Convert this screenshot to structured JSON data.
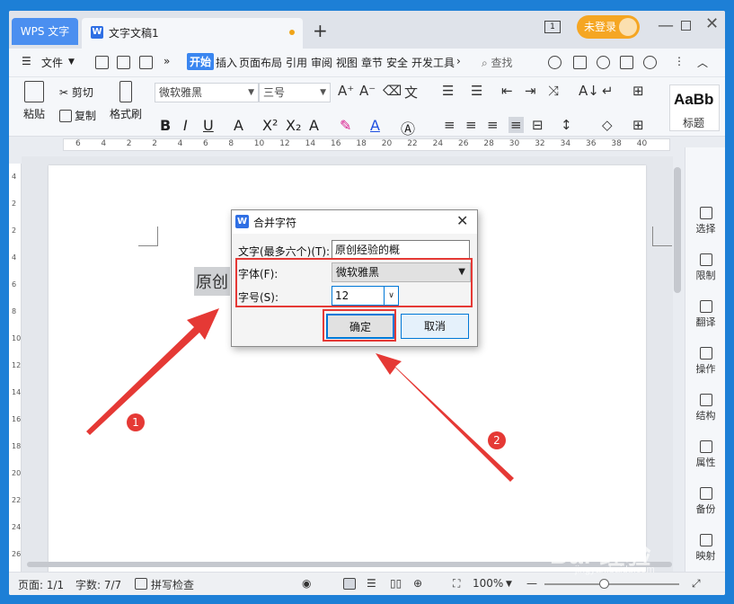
{
  "tabs": {
    "wps_label": "WPS 文字",
    "doc_title": "文字文稿1",
    "add": "+",
    "window_count": "1"
  },
  "account": {
    "login_label": "未登录"
  },
  "menu": {
    "file": "文件",
    "items": [
      "开始",
      "插入",
      "页面布局",
      "引用",
      "审阅",
      "视图",
      "章节",
      "安全",
      "开发工具"
    ],
    "more": "»",
    "search": "查找"
  },
  "ribbon": {
    "paste": "粘贴",
    "cut": "剪切",
    "copy": "复制",
    "format_painter": "格式刷",
    "font_name": "微软雅黑",
    "font_size": "三号",
    "style_preview": "AaBb",
    "style_label": "标题"
  },
  "ruler_top": [
    "6",
    "4",
    "2",
    "2",
    "4",
    "6",
    "8",
    "10",
    "12",
    "14",
    "16",
    "18",
    "20",
    "22",
    "24",
    "26",
    "28",
    "30",
    "32",
    "34",
    "36",
    "38",
    "40"
  ],
  "ruler_left": [
    "4",
    "2",
    "2",
    "4",
    "6",
    "8",
    "10",
    "12",
    "14",
    "16",
    "18",
    "20",
    "22",
    "24",
    "26"
  ],
  "document": {
    "selected_text": "原创"
  },
  "right_panel": [
    "选择",
    "限制",
    "翻译",
    "操作",
    "结构",
    "属性",
    "备份",
    "映射"
  ],
  "status": {
    "page": "页面: 1/1",
    "word_count": "字数: 7/7",
    "spell_check": "拼写检查",
    "zoom": "100%"
  },
  "dialog": {
    "title": "合并字符",
    "text_label": "文字(最多六个)(T):",
    "text_value": "原创经验的概",
    "font_label": "字体(F):",
    "font_value": "微软雅黑",
    "size_label": "字号(S):",
    "size_value": "12",
    "ok": "确定",
    "cancel": "取消"
  },
  "annotations": {
    "badge1": "1",
    "badge2": "2",
    "color": "#e53935"
  },
  "watermark": {
    "main": "Bai 经验",
    "sub": "jingyan.baidu.com"
  }
}
